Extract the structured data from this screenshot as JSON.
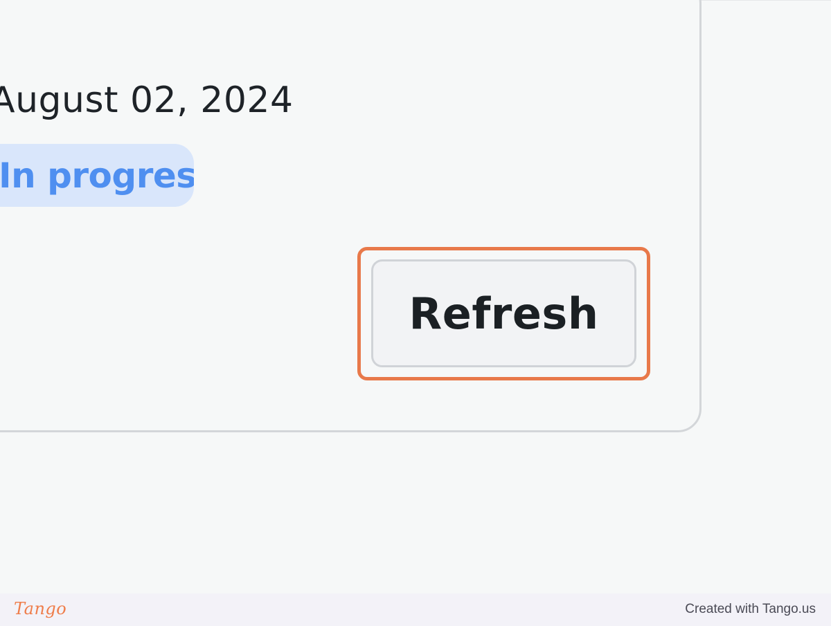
{
  "record": {
    "date": "August 02, 2024",
    "status": "In progress"
  },
  "actions": {
    "refresh_label": "Refresh"
  },
  "footer": {
    "logo_text": "Tango",
    "credit": "Created with Tango.us"
  },
  "colors": {
    "highlight": "#e8794a",
    "status_badge_bg": "#d9e6fb",
    "status_badge_text": "#4f8ff0",
    "card_border": "#d3d6d9",
    "background": "#f6f8f8"
  }
}
